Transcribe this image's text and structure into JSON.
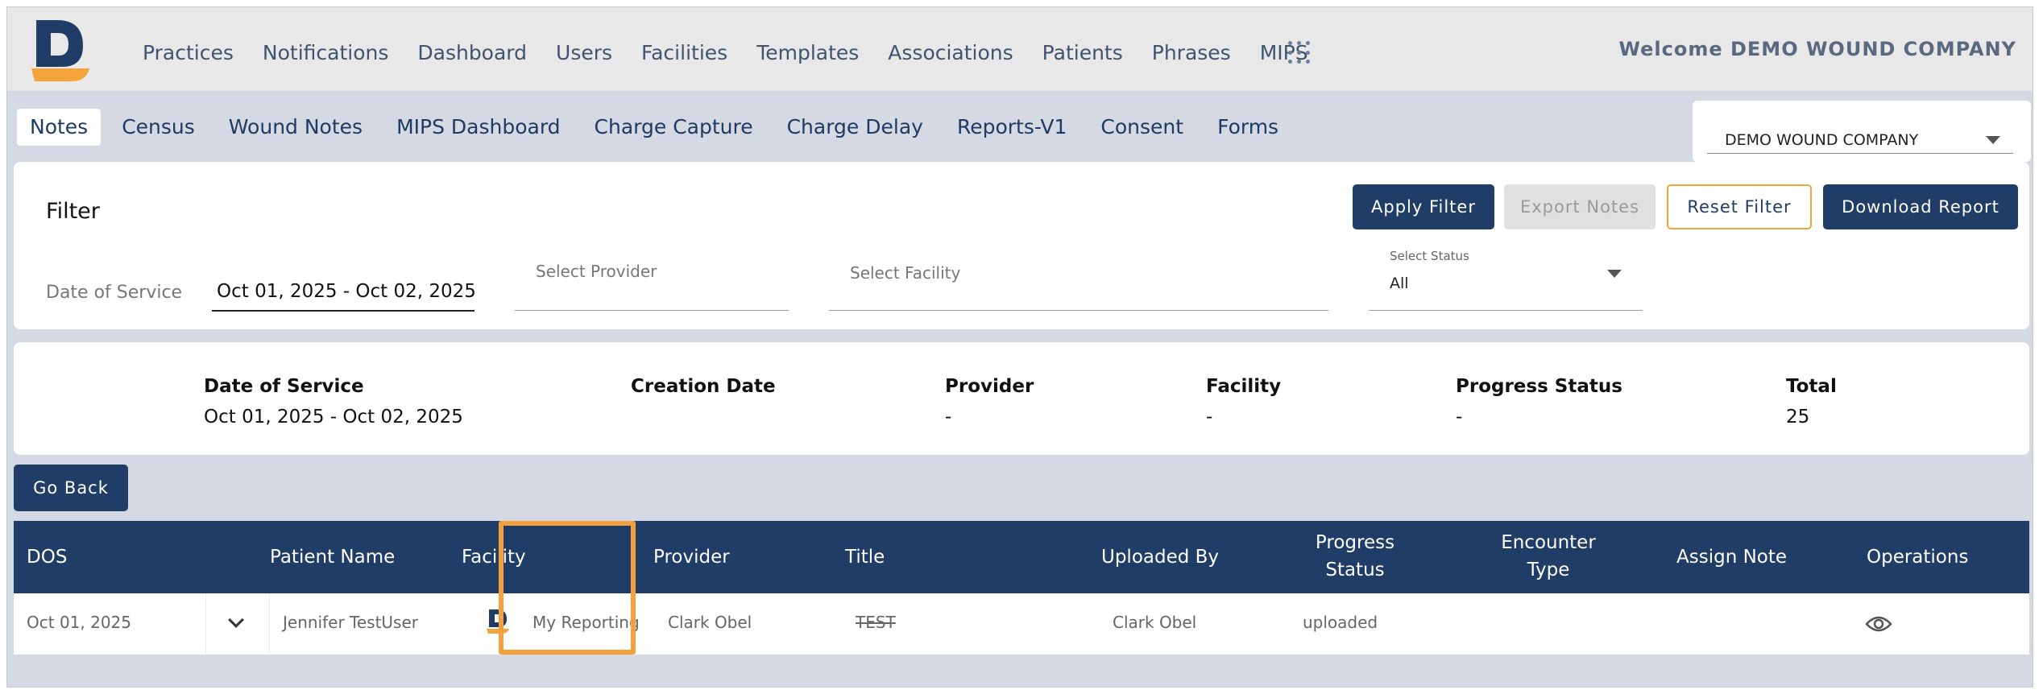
{
  "app": {
    "welcome": "Welcome DEMO WOUND COMPANY"
  },
  "nav": [
    "Practices",
    "Notifications",
    "Dashboard",
    "Users",
    "Facilities",
    "Templates",
    "Associations",
    "Patients",
    "Phrases",
    "MIPS"
  ],
  "subtabs": [
    "Notes",
    "Census",
    "Wound Notes",
    "MIPS Dashboard",
    "Charge Capture",
    "Charge Delay",
    "Reports-V1",
    "Consent",
    "Forms"
  ],
  "company_select": {
    "value": "DEMO WOUND COMPANY"
  },
  "filter": {
    "title": "Filter",
    "apply": "Apply Filter",
    "export": "Export Notes",
    "reset": "Reset Filter",
    "download": "Download Report",
    "dos_label": "Date of Service",
    "dos_value": "Oct 01, 2025 - Oct 02, 2025",
    "provider_placeholder": "Select Provider",
    "facility_placeholder": "Select Facility",
    "status_label": "Select Status",
    "status_value": "All"
  },
  "summary": {
    "dos": {
      "label": "Date of Service",
      "value": "Oct 01, 2025 - Oct 02, 2025"
    },
    "creation": {
      "label": "Creation Date",
      "value": ""
    },
    "provider": {
      "label": "Provider",
      "value": "-"
    },
    "facility": {
      "label": "Facility",
      "value": "-"
    },
    "progress": {
      "label": "Progress Status",
      "value": "-"
    },
    "total": {
      "label": "Total",
      "value": "25"
    }
  },
  "go_back": "Go Back",
  "table": {
    "headers": {
      "dos": "DOS",
      "patient": "Patient Name",
      "facility": "Facility",
      "provider": "Provider",
      "title": "Title",
      "uploaded_by": "Uploaded By",
      "progress_1": "Progress",
      "progress_2": "Status",
      "encounter_1": "Encounter",
      "encounter_2": "Type",
      "assign": "Assign Note",
      "operations": "Operations"
    },
    "rows": [
      {
        "dos": "Oct 01, 2025",
        "patient": "Jennifer TestUser",
        "facility": "My Reporting ",
        "provider": "Clark Obel",
        "title": "TEST",
        "uploaded_by": "Clark Obel",
        "status": "uploaded"
      }
    ]
  },
  "colors": {
    "primary": "#1f3d66",
    "accent": "#f3a43a",
    "background": "#d5d9e4"
  }
}
